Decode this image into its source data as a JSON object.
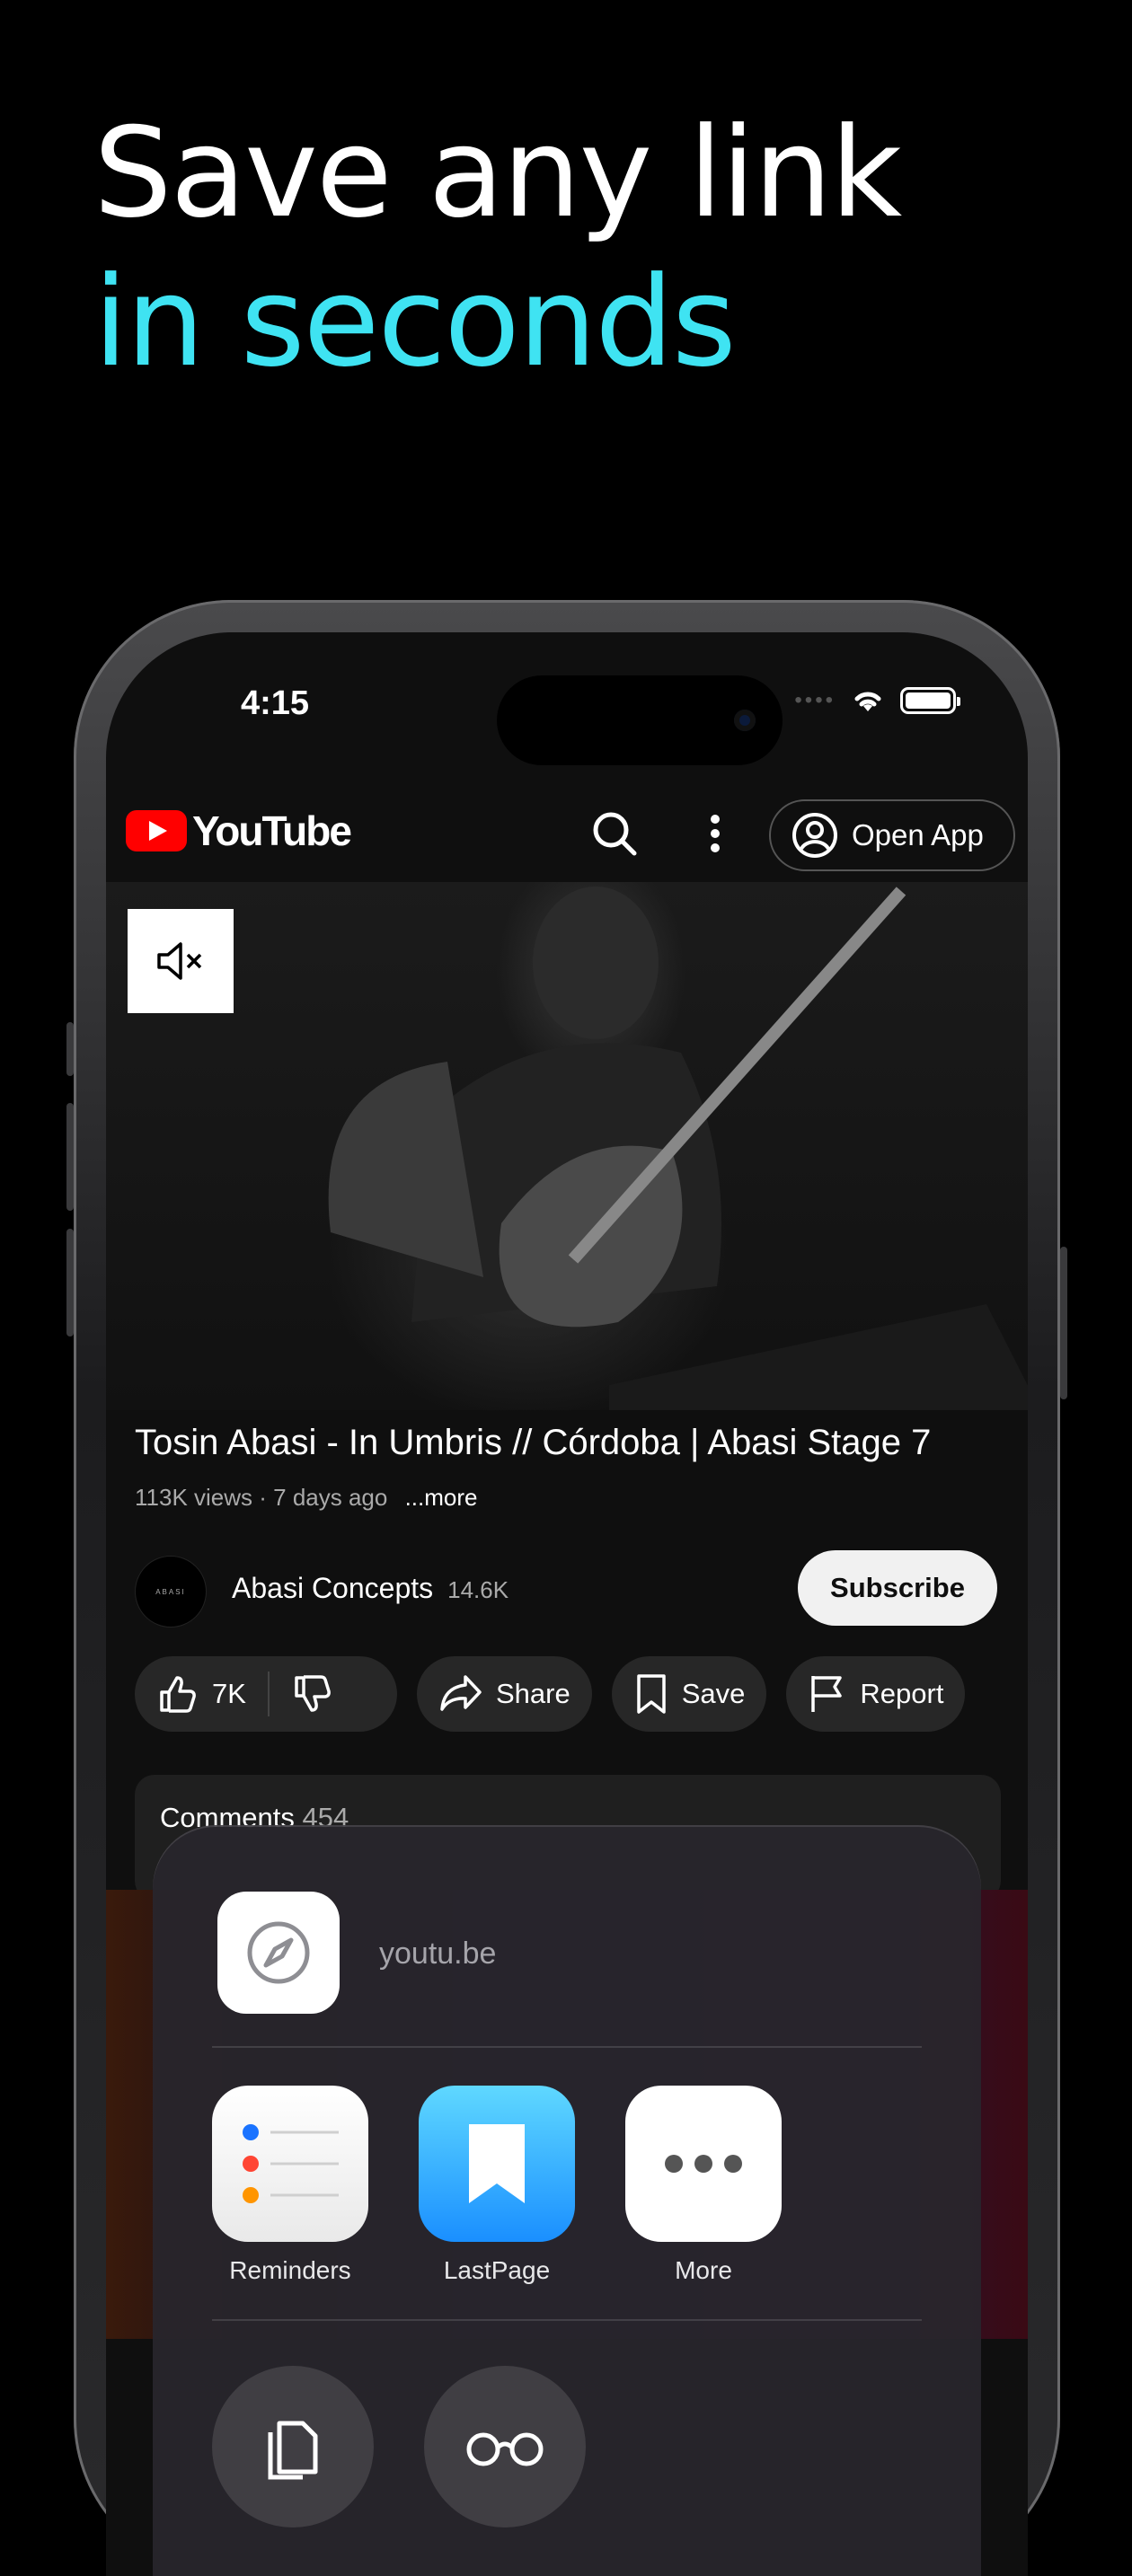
{
  "headline": {
    "line1": "Save any link",
    "line2": "in seconds",
    "accent_color": "#3fe3f2"
  },
  "status_bar": {
    "time": "4:15",
    "icons": [
      "wifi-icon",
      "battery-icon"
    ]
  },
  "youtube": {
    "logo_text": "YouTube",
    "open_app_label": "Open App",
    "video_title": "Tosin Abasi - In Umbris // Córdoba | Abasi Stage 7",
    "views": "113K views · 7 days ago",
    "more_label": "...more",
    "channel_name": "Abasi Concepts",
    "channel_subs": "14.6K",
    "channel_avatar_text": "ABASI",
    "subscribe_label": "Subscribe",
    "likes": "7K",
    "share_label": "Share",
    "save_label": "Save",
    "report_label": "Report",
    "comments_label": "Comments",
    "comments_count": "454"
  },
  "share_sheet": {
    "url": "youtu.be",
    "apps": [
      {
        "label": "Reminders",
        "icon": "reminders-icon"
      },
      {
        "label": "LastPage",
        "icon": "lastpage-bookmark-icon"
      },
      {
        "label": "More",
        "icon": "more-dots-icon"
      }
    ],
    "actions": [
      {
        "icon": "copy-icon"
      },
      {
        "icon": "reading-list-glasses-icon"
      }
    ]
  }
}
